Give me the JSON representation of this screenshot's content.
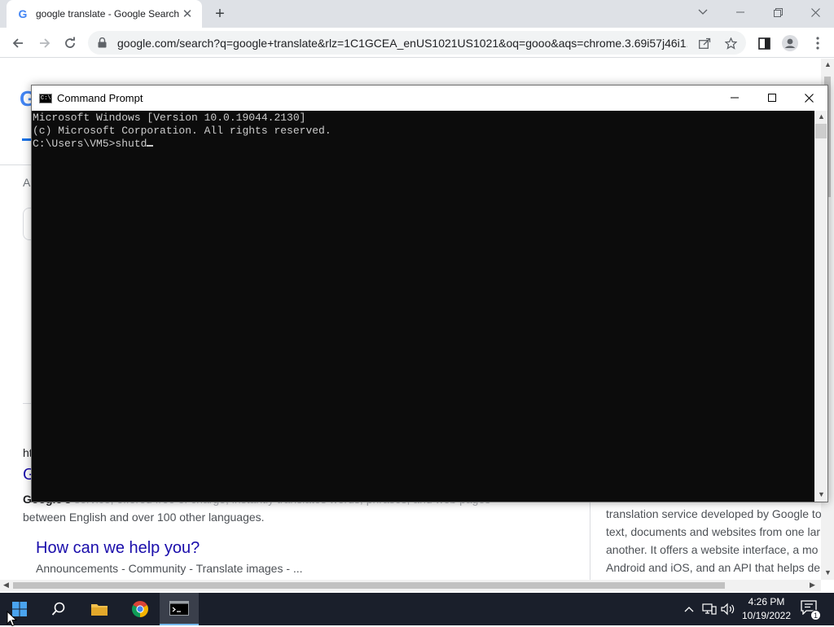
{
  "browser": {
    "tab_title": "google translate - Google Search",
    "tab_favicon": "G",
    "url": "google.com/search?q=google+translate&rlz=1C1GCEA_enUS1021US1021&oq=gooo&aqs=chrome.3.69i57j46i1..."
  },
  "page": {
    "partial_h": "ht",
    "partial_g": "G",
    "result_desc_line2": "between English and over 100 other languages.",
    "result_desc_bold": "Google's",
    "result_desc_line1": " service, offered free of charge, instantly translates words, phrases, and web pages",
    "sitelink_title": "How can we help you?",
    "sitelink_desc": "Announcements - Community - Translate images - ...",
    "kp_lines": [
      "translation service developed by Google to",
      "text, documents and websites from one lar",
      "another. It offers a website interface, a mo",
      "Android and iOS, and an API that helps de"
    ]
  },
  "cmd": {
    "title": "Command Prompt",
    "icon_text": "C:\\",
    "lines": [
      "Microsoft Windows [Version 10.0.19044.2130]",
      "(c) Microsoft Corporation. All rights reserved."
    ],
    "prompt": "C:\\Users\\VM5>",
    "input": "shutd"
  },
  "taskbar": {
    "time": "4:26 PM",
    "date": "10/19/2022",
    "notification_count": "1",
    "pinned": [
      "start-icon",
      "search-icon",
      "file-explorer-icon",
      "chrome-icon",
      "command-prompt-icon"
    ]
  },
  "colors": {
    "console_bg": "#0c0c0c",
    "console_text": "#cccccc",
    "taskbar_bg": "#1a1f2b",
    "link": "#1a0dab"
  }
}
